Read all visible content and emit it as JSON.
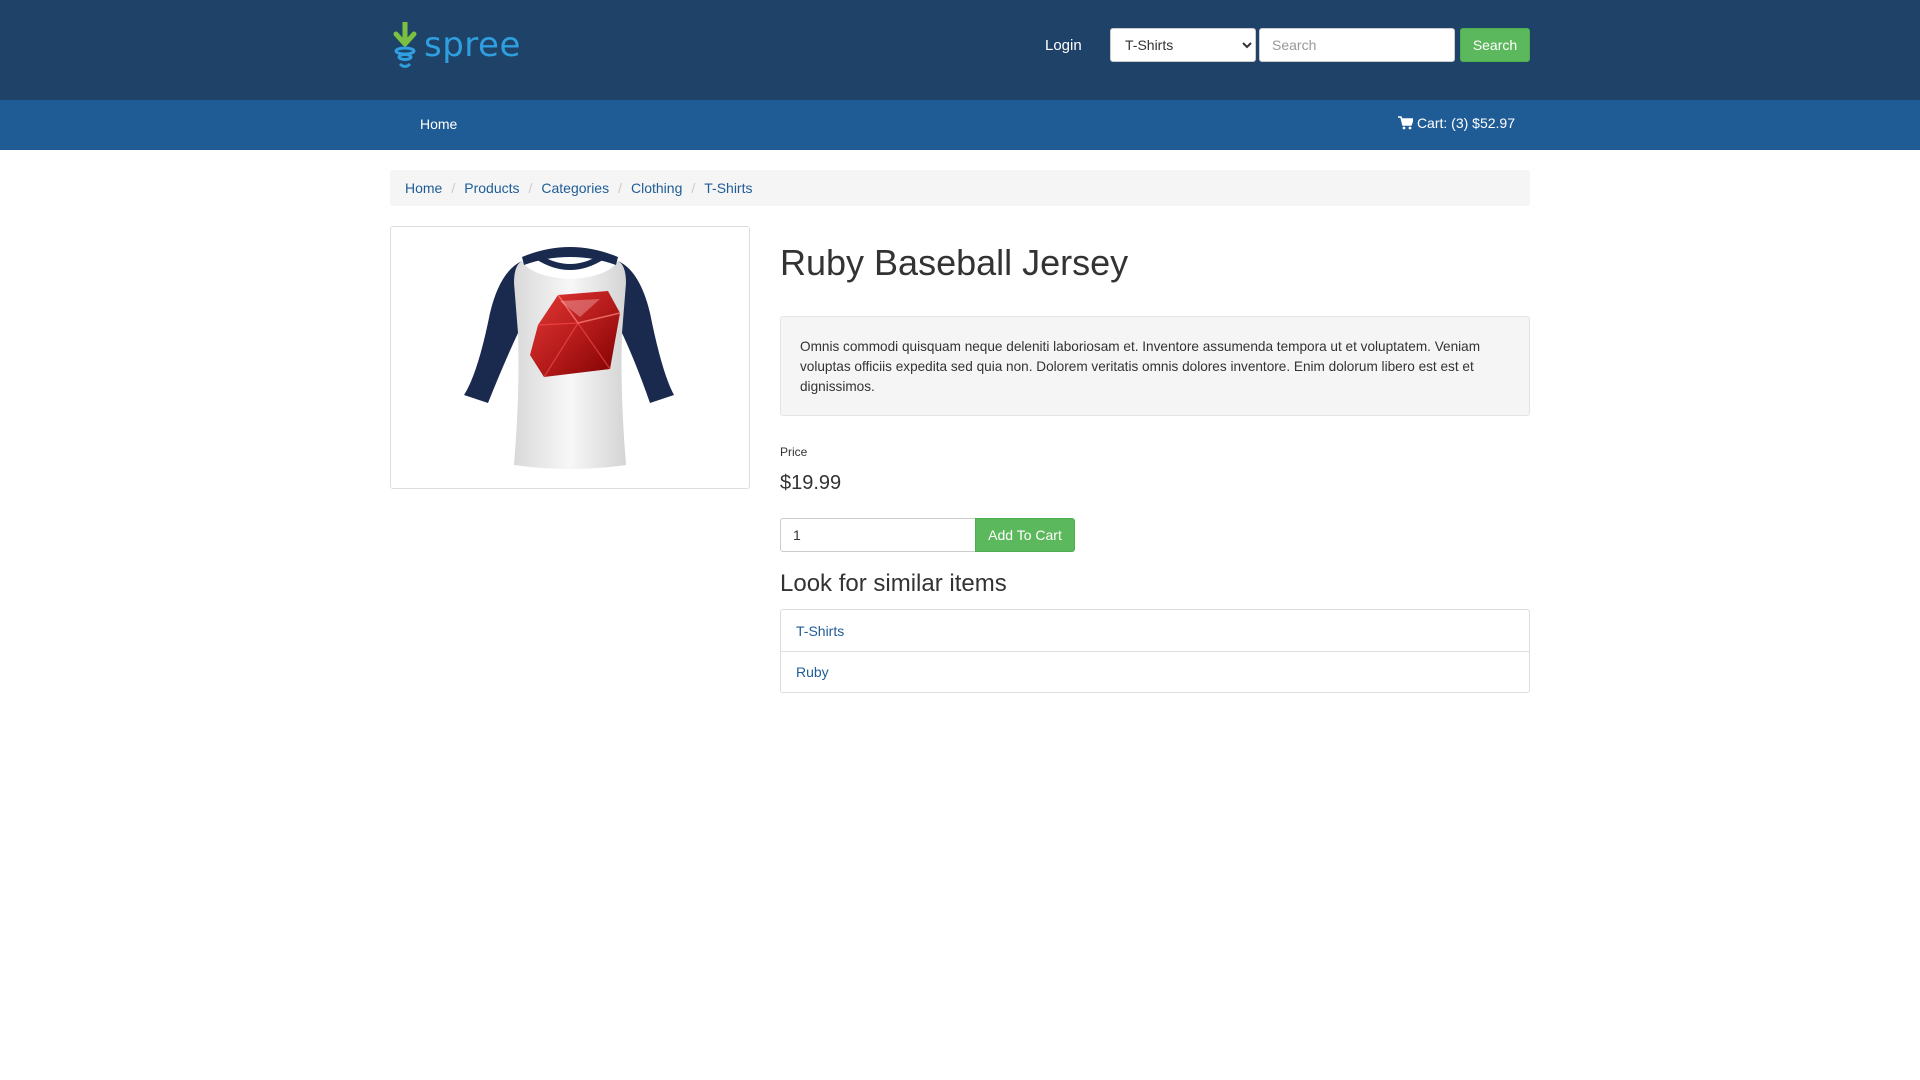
{
  "brand": {
    "logo_text": "spree",
    "logo_icon": "spree-logo-icon",
    "colors": {
      "header_bg": "#1e4268",
      "nav_bg": "#1f5c96",
      "accent_green": "#5cb85c",
      "link_blue": "#1f5c96",
      "logo_blue": "#2f9fe0",
      "logo_green": "#7ac142"
    }
  },
  "header": {
    "login_label": "Login",
    "taxon_select": {
      "selected": "T-Shirts",
      "options": [
        "T-Shirts"
      ]
    },
    "search": {
      "placeholder": "Search",
      "value": ""
    },
    "search_button_label": "Search"
  },
  "nav": {
    "home_label": "Home",
    "cart_icon": "cart-icon",
    "cart_label": "Cart: (3) $52.97"
  },
  "breadcrumb": [
    {
      "label": "Home"
    },
    {
      "label": "Products"
    },
    {
      "label": "Categories"
    },
    {
      "label": "Clothing"
    },
    {
      "label": "T-Shirts"
    }
  ],
  "product": {
    "image_icon": "ruby-baseball-jersey-image",
    "title": "Ruby Baseball Jersey",
    "description": "Omnis commodi quisquam neque deleniti laboriosam et. Inventore assumenda tempora ut et voluptatem. Veniam voluptas officiis expedita sed quia non. Dolorem veritatis omnis dolores inventore. Enim dolorum libero est est et dignissimos.",
    "price_label": "Price",
    "price": "$19.99",
    "quantity": "1",
    "add_to_cart_label": "Add To Cart"
  },
  "similar": {
    "heading": "Look for similar items",
    "items": [
      {
        "label": "T-Shirts"
      },
      {
        "label": "Ruby"
      }
    ]
  }
}
